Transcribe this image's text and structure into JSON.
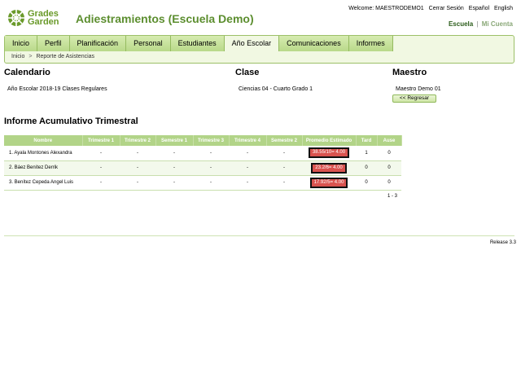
{
  "logo": {
    "line1": "Grades",
    "line2": "Garden"
  },
  "header": {
    "school_title": "Adiestramientos (Escuela Demo)",
    "welcome": "Welcome: MAESTRODEMO1",
    "logout": "Cerrar Sesión",
    "lang_es": "Español",
    "lang_en": "English",
    "account_current": "Escuela",
    "account_separator": "|",
    "account_other": "Mi Cuenta"
  },
  "nav": {
    "tabs": [
      {
        "label": "Inicio"
      },
      {
        "label": "Perfil"
      },
      {
        "label": "Planificación"
      },
      {
        "label": "Personal"
      },
      {
        "label": "Estudiantes"
      },
      {
        "label": "Año Escolar"
      },
      {
        "label": "Comunicaciones"
      },
      {
        "label": "Informes"
      }
    ],
    "active_index": 5,
    "breadcrumb": {
      "home": "Inicio",
      "separator": ">",
      "current": "Reporte de Asistencias"
    }
  },
  "info": {
    "calendario": {
      "title": "Calendario",
      "value": "Año Escolar 2018-19  Clases Regulares"
    },
    "clase": {
      "title": "Clase",
      "value": "Ciencias 04 -  Cuarto Grado  1"
    },
    "maestro": {
      "title": "Maestro",
      "value": "Maestro Demo 01"
    },
    "back_button": "<< Regresar"
  },
  "report": {
    "title": "Informe Acumulativo Trimestral",
    "columns": [
      "Nombre",
      "Trimestre 1",
      "Trimestre 2",
      "Semestre 1",
      "Trimestre 3",
      "Trimestre 4",
      "Semestre 2",
      "Promedio Estimado",
      "Tard",
      "Ause"
    ],
    "rows": [
      {
        "name": "1. Ayala Montones Alexandra",
        "t1": "-",
        "t2": "-",
        "s1": "-",
        "t3": "-",
        "t4": "-",
        "s2": "-",
        "avg": "38.55/10= 4.00",
        "tard": "1",
        "ause": "0"
      },
      {
        "name": "2. Báez Benítez Derrik",
        "t1": "-",
        "t2": "-",
        "s1": "-",
        "t3": "-",
        "t4": "-",
        "s2": "-",
        "avg": "23.2/6= 4.00",
        "tard": "0",
        "ause": "0"
      },
      {
        "name": "3. Benítez Cepeda Angel Luis",
        "t1": "-",
        "t2": "-",
        "s1": "-",
        "t3": "-",
        "t4": "-",
        "s2": "-",
        "avg": "17.92/5= 4.00",
        "tard": "0",
        "ause": "0"
      }
    ],
    "pager": "1 - 3"
  },
  "footer": {
    "release": "Release 3.3"
  },
  "colors": {
    "brand_green": "#5c8e2f",
    "tab_green": "#b9d98a",
    "header_row": "#b2d488",
    "grade_red": "#d9534f"
  }
}
